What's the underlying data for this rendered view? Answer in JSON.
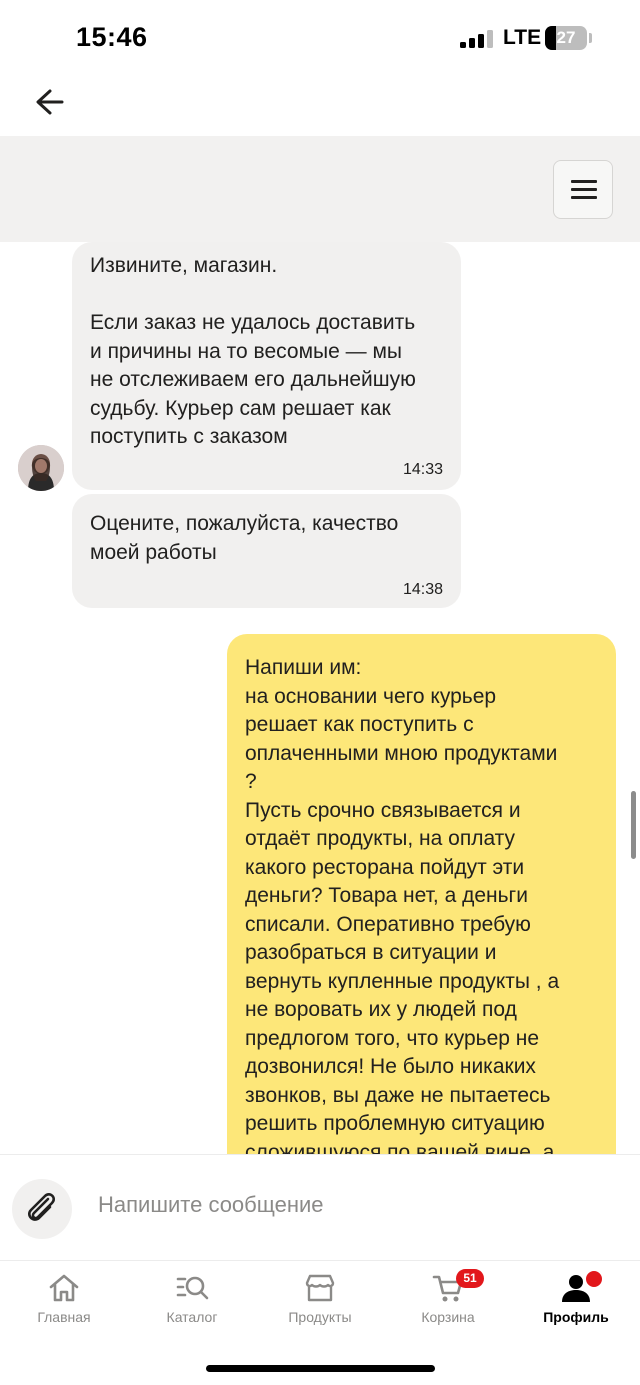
{
  "status_bar": {
    "time": "15:46",
    "network": "LTE",
    "battery_level": "27",
    "battery_fraction": 0.27
  },
  "header": {
    "back_icon": "arrow-left-icon",
    "menu_icon": "list-menu-icon"
  },
  "messages": [
    {
      "direction": "incoming",
      "lines": [
        "Извините, магазин.",
        "",
        "Если заказ не удалось доставить",
        "и причины на то весомые — мы",
        "не отслеживаем его дальнейшую",
        "судьбу. Курьер сам решает как",
        "поступить с заказом"
      ],
      "time": "14:33"
    },
    {
      "direction": "incoming",
      "lines": [
        "Оцените, пожалуйста, качество",
        "моей работы"
      ],
      "time": "14:38"
    },
    {
      "direction": "outgoing",
      "lines": [
        "Напиши им:",
        "на основании чего курьер",
        "решает как поступить с",
        "оплаченными мною продуктами",
        "?",
        "Пусть срочно связывается и",
        "отдаёт продукты, на оплату",
        "какого ресторана пойдут эти",
        "деньги? Товара нет, а деньги",
        "списали. Оперативно требую",
        "разобраться в ситуации и",
        "вернуть купленные продукты , а",
        "не воровать их у людей под",
        "предлогом того, что курьер не",
        "дозвонился! Не было никаких",
        "звонков, вы даже не пытаетесь",
        "решить проблемную ситуацию",
        "сложившуюся по вашей вине, а"
      ]
    }
  ],
  "input": {
    "placeholder": "Напишите сообщение",
    "attach_icon": "paperclip-icon"
  },
  "tabs": [
    {
      "label": "Главная",
      "icon": "home-icon",
      "active": false
    },
    {
      "label": "Каталог",
      "icon": "catalog-search-icon",
      "active": false
    },
    {
      "label": "Продукты",
      "icon": "shop-icon",
      "active": false
    },
    {
      "label": "Корзина",
      "icon": "cart-icon",
      "active": false,
      "badge": "51"
    },
    {
      "label": "Профиль",
      "icon": "profile-icon",
      "active": true
    }
  ],
  "colors": {
    "incoming_bubble": "#f1f0ef",
    "outgoing_bubble": "#fde779",
    "badge": "#e2171b",
    "header_band": "#f2f1f0"
  }
}
